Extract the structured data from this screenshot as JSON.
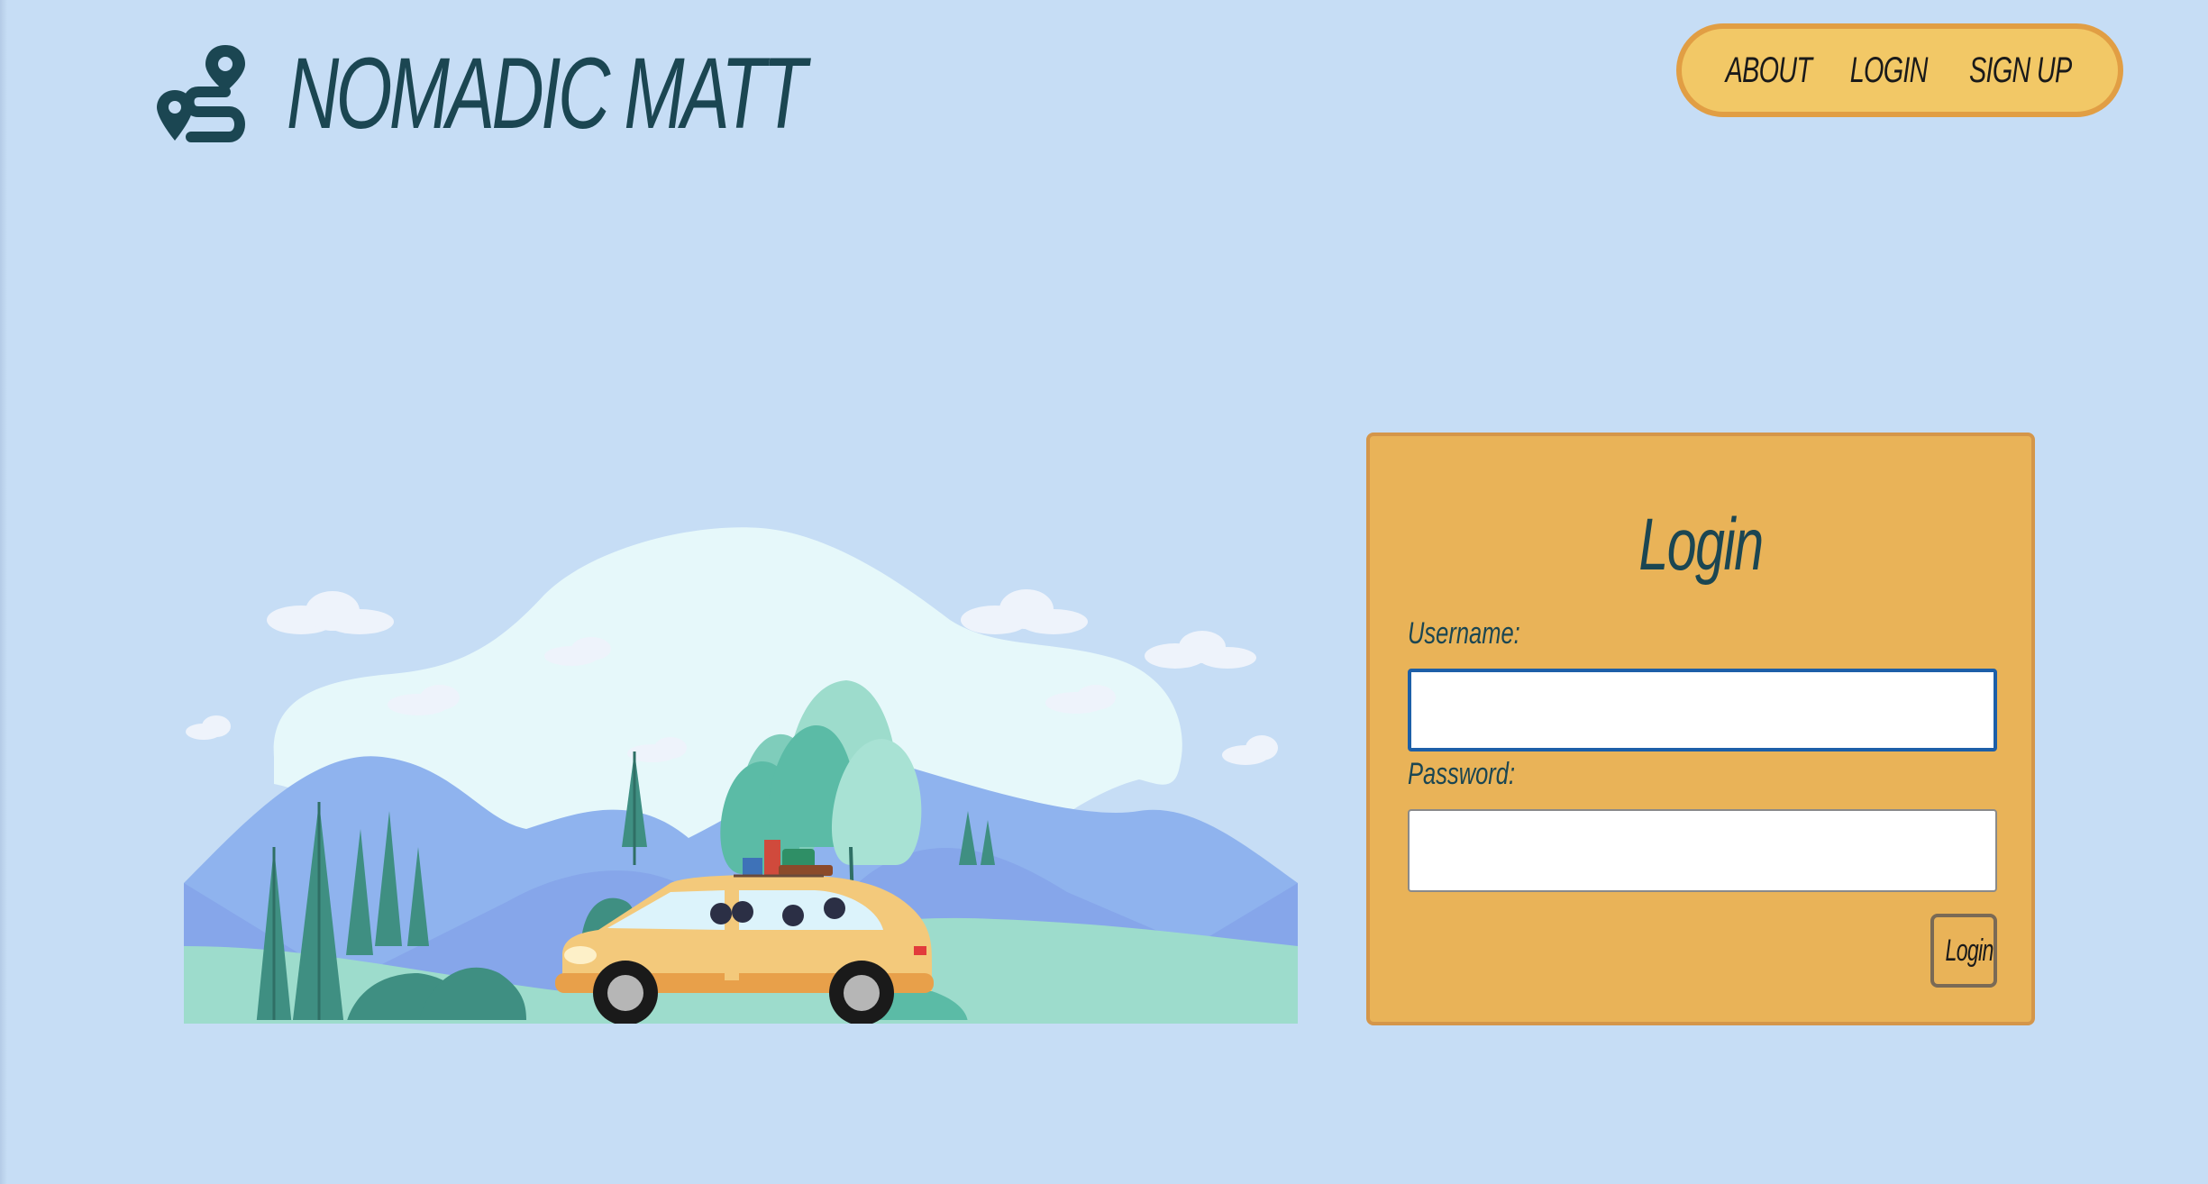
{
  "brand": {
    "name": "NOMADIC MATT",
    "icon": "route-pin-icon",
    "color": "#1b4652"
  },
  "nav": {
    "items": [
      {
        "label": "ABOUT"
      },
      {
        "label": "LOGIN"
      },
      {
        "label": "SIGN UP"
      }
    ],
    "background": "#f2c866",
    "border": "#e19e44"
  },
  "hero": {
    "illustration": "road-trip-car-illustration"
  },
  "login": {
    "title": "Login",
    "username_label": "Username:",
    "username_value": "",
    "password_label": "Password:",
    "password_value": "",
    "submit_label": "Login",
    "card_color": "#e9b358"
  },
  "colors": {
    "page_background": "#c6ddf5",
    "focus_border": "#1d5fa8"
  }
}
